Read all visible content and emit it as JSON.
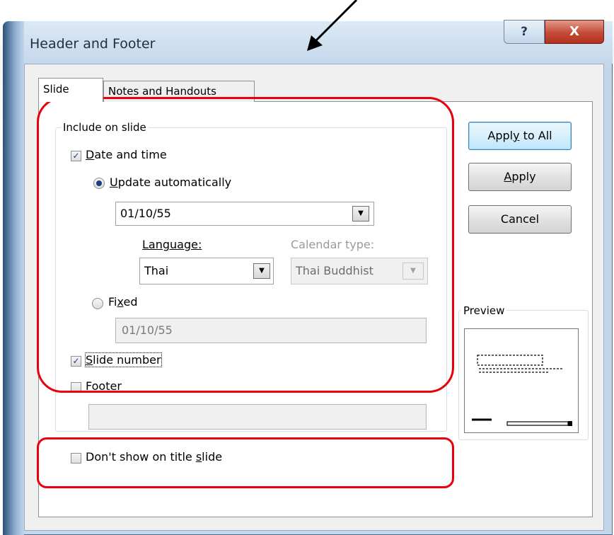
{
  "window": {
    "title": "Header and Footer",
    "help_label": "?",
    "close_label": "X"
  },
  "tabs": [
    {
      "label": "Slide"
    },
    {
      "label": "Notes and Handouts"
    }
  ],
  "include_on_slide": {
    "group_label": "Include on slide",
    "date_and_time": {
      "label_pre": "",
      "label_key": "D",
      "label_post": "ate and time",
      "checked": true
    },
    "update_automatically": {
      "label_key": "U",
      "label_post": "pdate automatically",
      "selected": true
    },
    "date_value": "01/10/55",
    "language_label": "Language:",
    "language_value": "Thai",
    "calendar_type_label": "Calendar type:",
    "calendar_type_value": "Thai Buddhist",
    "fixed": {
      "label_pre": "Fi",
      "label_key": "x",
      "label_post": "ed",
      "selected": false
    },
    "fixed_value": "01/10/55",
    "slide_number": {
      "label_key": "S",
      "label_post": "lide number",
      "checked": true
    },
    "footer": {
      "label_key": "F",
      "label_post": "ooter",
      "checked": false
    },
    "footer_value": ""
  },
  "dont_show_on_title_slide": {
    "label_pre": "Don't show on title ",
    "label_key": "s",
    "label_post": "lide",
    "checked": false
  },
  "buttons": {
    "apply_to_all": {
      "pre": "Appl",
      "key": "y",
      "post": " to All"
    },
    "apply": {
      "key": "A",
      "post": "pply"
    },
    "cancel": "Cancel"
  },
  "preview": {
    "label": "Preview"
  },
  "colors": {
    "highlight": "#e8000b",
    "arrow": "#000000"
  }
}
